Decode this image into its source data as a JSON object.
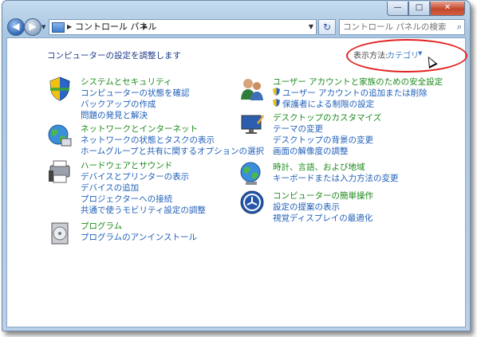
{
  "address": {
    "crumb": "コントロール パネル",
    "search_placeholder": "コントロール パネルの検索"
  },
  "window_controls": {
    "minimize": "—",
    "maximize": "□",
    "close": "✕"
  },
  "page": {
    "heading": "コンピューターの設定を調整します",
    "view_by_label": "表示方法:",
    "view_by_value": "カテゴリ"
  },
  "categories": [
    {
      "title": "システムとセキュリティ",
      "icon": "shield-security-icon",
      "links": [
        "コンピューターの状態を確認",
        "バックアップの作成",
        "問題の発見と解決"
      ]
    },
    {
      "title": "ネットワークとインターネット",
      "icon": "globe-network-icon",
      "links": [
        "ネットワークの状態とタスクの表示",
        "ホームグループと共有に関するオプションの選択"
      ]
    },
    {
      "title": "ハードウェアとサウンド",
      "icon": "printer-speaker-icon",
      "links": [
        "デバイスとプリンターの表示",
        "デバイスの追加",
        "プロジェクターへの接続",
        "共通で使うモビリティ設定の調整"
      ]
    },
    {
      "title": "プログラム",
      "icon": "programs-disc-icon",
      "links": [
        "プログラムのアンインストール"
      ]
    },
    {
      "title": "ユーザー アカウントと家族のための安全設定",
      "icon": "users-icon",
      "links": [
        "ユーザー アカウントの追加または削除",
        "保護者による制限の設定"
      ]
    },
    {
      "title": "デスクトップのカスタマイズ",
      "icon": "desktop-customize-icon",
      "links": [
        "テーマの変更",
        "デスクトップの背景の変更",
        "画面の解像度の調整"
      ]
    },
    {
      "title": "時計、言語、および地域",
      "icon": "clock-globe-icon",
      "links": [
        "キーボードまたは入力方法の変更"
      ]
    },
    {
      "title": "コンピューターの簡単操作",
      "icon": "ease-of-access-icon",
      "links": [
        "設定の提案の表示",
        "視覚ディスプレイの最適化"
      ]
    }
  ]
}
